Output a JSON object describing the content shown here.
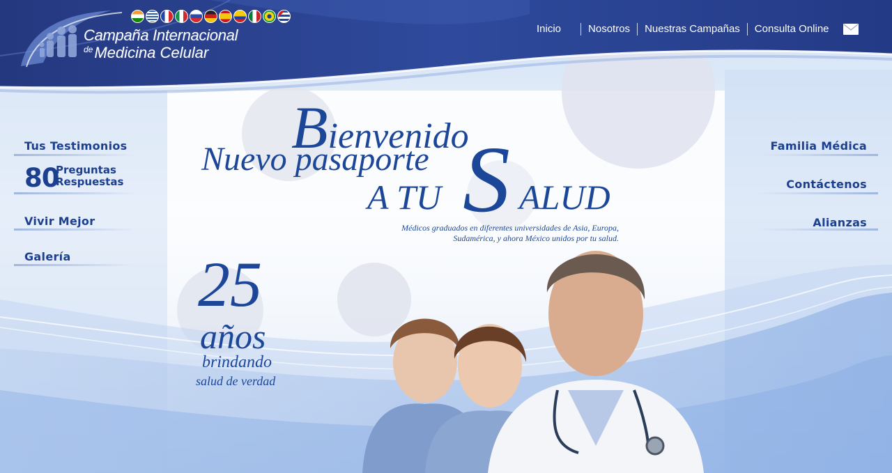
{
  "logo": {
    "line1": "Campaña Internacional",
    "line2_prefix": "de",
    "line2": "Medicina Celular",
    "flags": [
      "india-flag-icon",
      "greece-flag-icon",
      "france-flag-icon",
      "italy-flag-icon",
      "russia-flag-icon",
      "germany-flag-icon",
      "spain-flag-icon",
      "colombia-flag-icon",
      "mexico-flag-icon",
      "brazil-flag-icon",
      "cuba-flag-icon"
    ]
  },
  "nav": {
    "items": [
      "Inicio",
      "Nosotros",
      "Nuestras Campañas",
      "Consulta Online"
    ],
    "mail_icon": "mail-icon"
  },
  "left_menu": {
    "testimonios": "Tus Testimonios",
    "faq_number": "80",
    "faq_line1": "Preguntas",
    "faq_line2": "Respuestas",
    "vivir": "Vivir Mejor",
    "galeria": "Galería"
  },
  "right_menu": {
    "familia": "Familia Médica",
    "contacto": "Contáctenos",
    "alianzas": "Alianzas"
  },
  "hero": {
    "bienvenido_initial": "B",
    "bienvenido_rest": "ienvenido",
    "line2": "Nuevo pasaporte",
    "big_s": "S",
    "line3_a": "A TU",
    "line3_b": "ALUD",
    "subtitle_line1": "Médicos graduados en diferentes universidades de Asia, Europa,",
    "subtitle_line2": "Sudamérica, y ahora México unidos por tu salud."
  },
  "anniversary": {
    "number": "25",
    "word": "años",
    "line1": "brindando",
    "line2": "salud de verdad"
  },
  "colors": {
    "header_blue": "#2b3f8f",
    "text_blue": "#1c4799",
    "menu_blue": "#1c3f8f"
  }
}
